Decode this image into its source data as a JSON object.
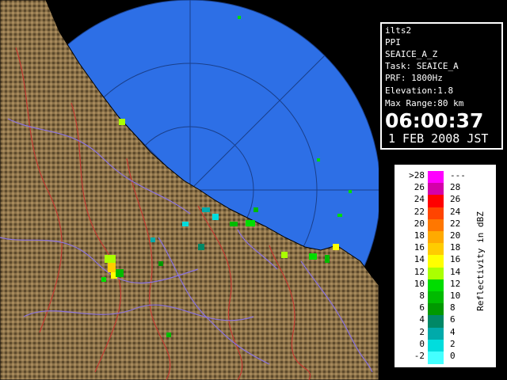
{
  "info": {
    "lines": [
      "ilts2",
      "PPI",
      "SEAICE_A_Z",
      "Task: SEAICE_A",
      "PRF: 1800Hz",
      "Elevation:1.8",
      "Max Range:80 km"
    ],
    "time": "06:00:37",
    "date": "1 FEB 2008 JST"
  },
  "legend": {
    "unit_label": "Reflectivity in dBZ",
    "top_left": ">28",
    "top_right": "---",
    "left_labels": [
      "26",
      "24",
      "22",
      "20",
      "18",
      "16",
      "14",
      "12",
      "10",
      "8",
      "6",
      "4",
      "2",
      "0",
      "-2"
    ],
    "right_labels": [
      "28",
      "26",
      "24",
      "22",
      "20",
      "18",
      "16",
      "14",
      "12",
      "10",
      "8",
      "6",
      "4",
      "2",
      "0"
    ],
    "colors": [
      "#ff00ff",
      "#d400aa",
      "#ff0000",
      "#ff4400",
      "#ff7700",
      "#ffaa00",
      "#ffcc00",
      "#ffff00",
      "#aaff00",
      "#00dd00",
      "#00bb00",
      "#009900",
      "#008866",
      "#00aaaa",
      "#00dddd",
      "#44ffff"
    ]
  },
  "colors": {
    "sea": "#2d6fe6",
    "outside": "#000000",
    "land": "#8a7148",
    "river": "#8a73e0",
    "ridge": "#c43a30"
  }
}
